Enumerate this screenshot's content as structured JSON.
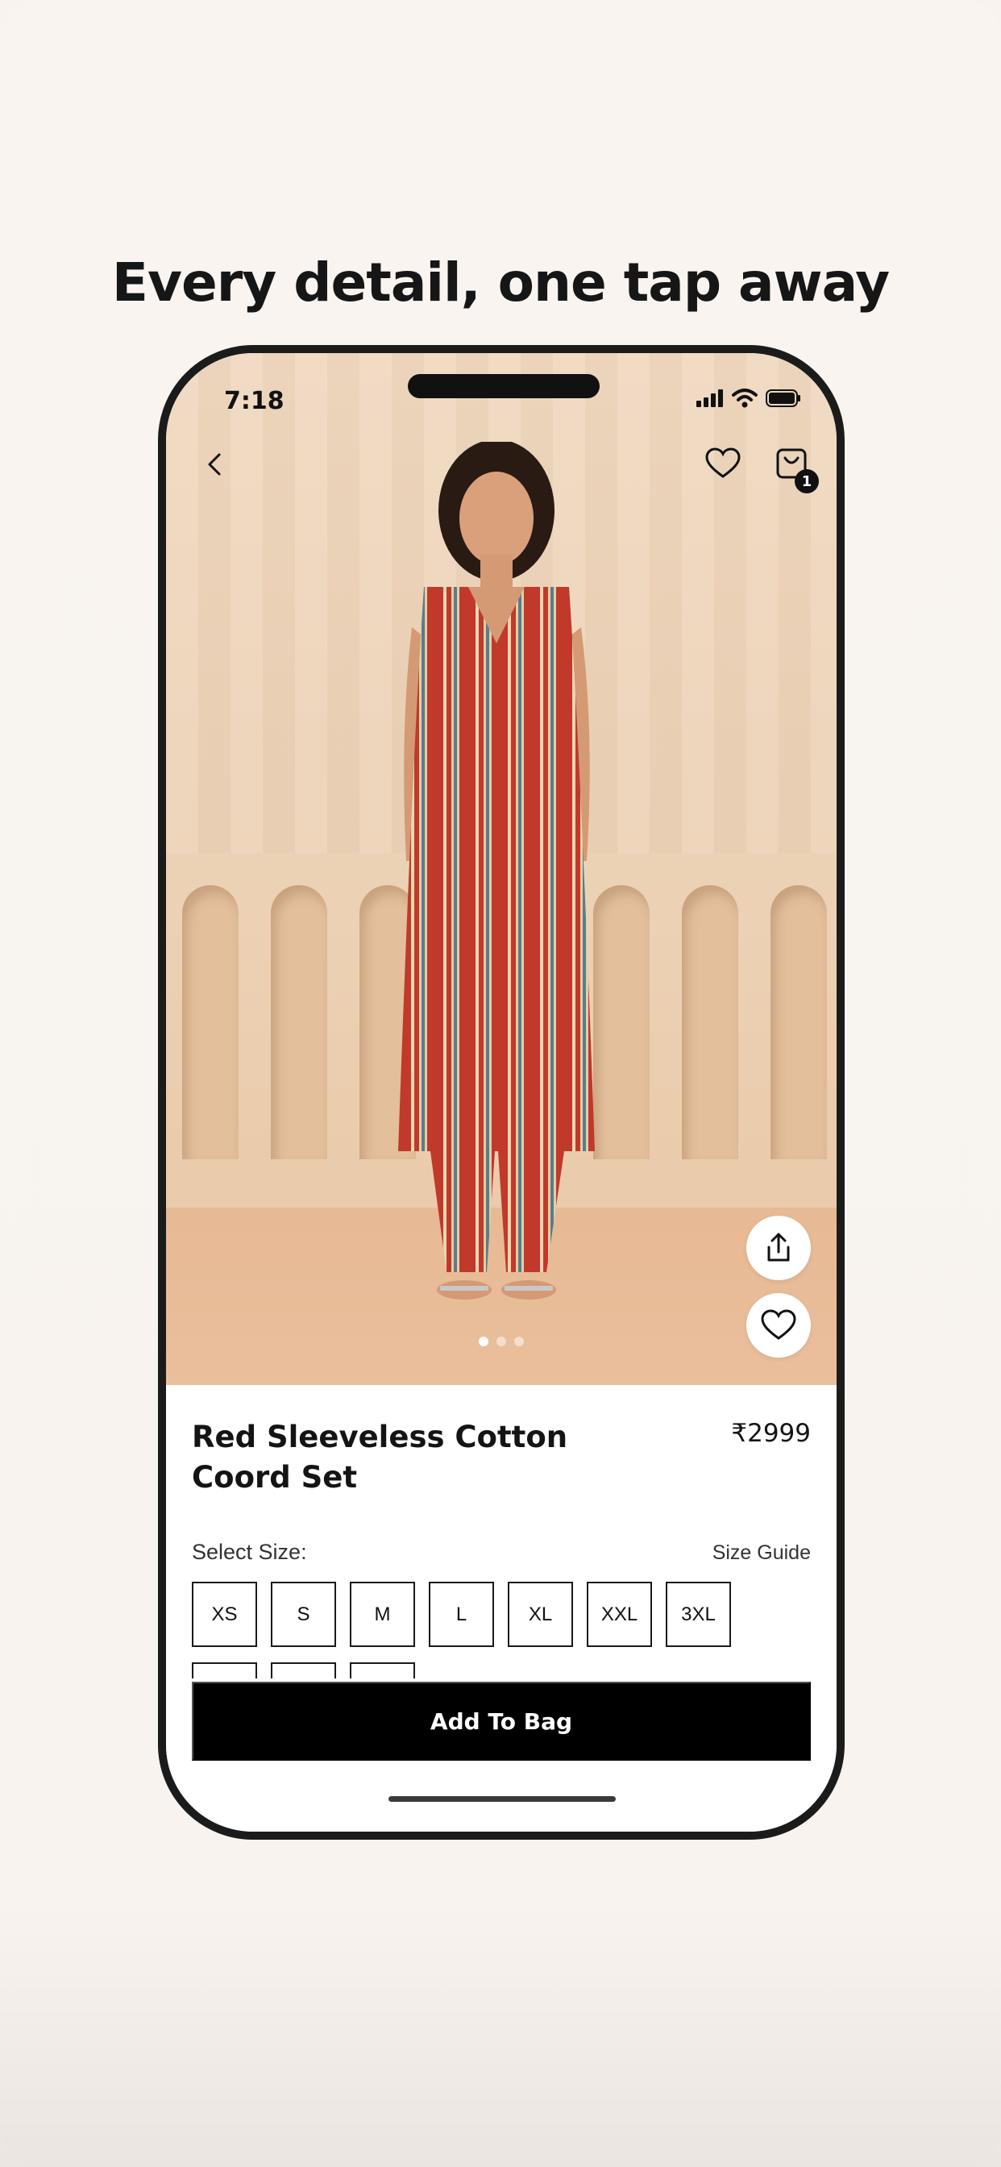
{
  "headline": "Every detail, one tap away",
  "status_bar": {
    "time": "7:18"
  },
  "header": {
    "cart_count": "1"
  },
  "carousel": {
    "pages": 3,
    "active_page": 1
  },
  "product": {
    "title": "Red Sleeveless Cotton Coord Set",
    "price": "₹2999"
  },
  "size_section": {
    "label": "Select Size:",
    "guide_link": "Size Guide",
    "sizes": [
      "XS",
      "S",
      "M",
      "L",
      "XL",
      "XXL",
      "3XL"
    ]
  },
  "cta": {
    "add_to_bag": "Add To Bag"
  },
  "icons": {
    "back": "chevron-left-icon",
    "wishlist": "heart-icon",
    "cart": "shopping-bag-icon",
    "share": "share-icon"
  }
}
